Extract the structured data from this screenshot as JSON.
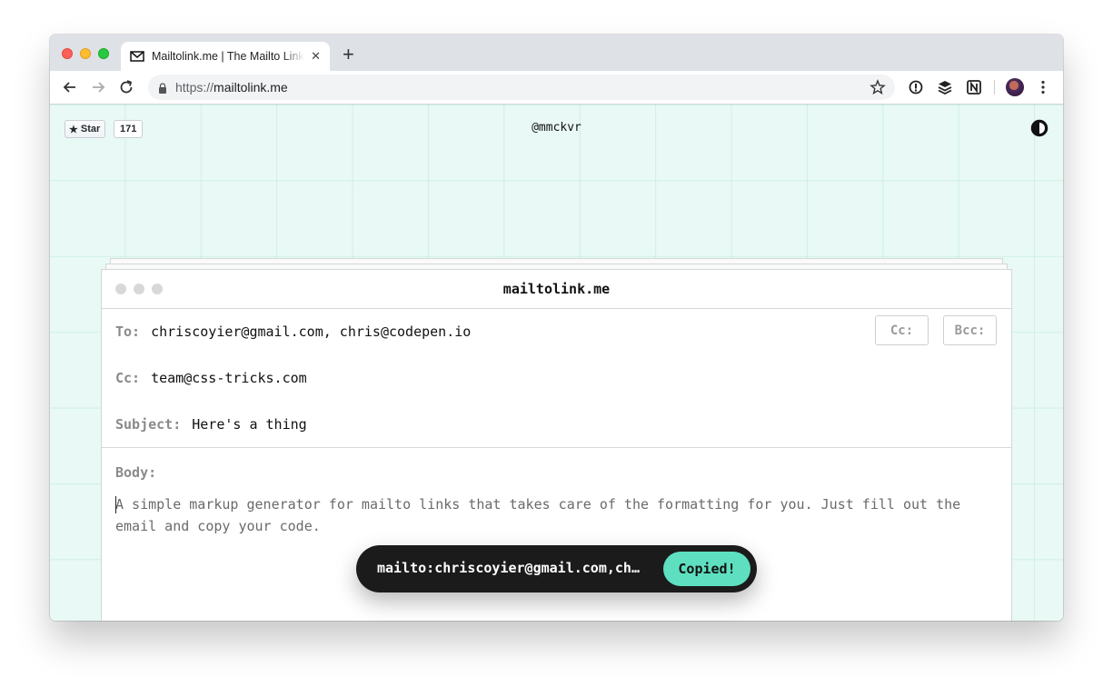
{
  "browser": {
    "tab_title": "Mailtolink.me | The Mailto Link Generator",
    "tab_close": "✕",
    "new_tab": "+",
    "url_scheme": "https://",
    "url_host": "mailtolink.me"
  },
  "page": {
    "github_star_label": "Star",
    "github_star_count": "171",
    "handle": "@mmckvr"
  },
  "composer": {
    "title": "mailtolink.me",
    "to_label": "To:",
    "to_value": "chriscoyier@gmail.com, chris@codepen.io",
    "cc_label": "Cc:",
    "cc_value": "team@css-tricks.com",
    "subject_label": "Subject:",
    "subject_value": "Here's a thing",
    "body_label": "Body:",
    "body_placeholder": "A simple markup generator for mailto links that takes care of the formatting for you. Just fill out the email and copy your code.",
    "cc_button": "Cc:",
    "bcc_button": "Bcc:"
  },
  "toast": {
    "link_text": "mailto:chriscoyier@gmail.com,ch…",
    "button_label": "Copied!"
  },
  "colors": {
    "background_mint": "#e9f9f5",
    "accent": "#5ee0c0",
    "toast_bg": "#1b1b1b"
  }
}
